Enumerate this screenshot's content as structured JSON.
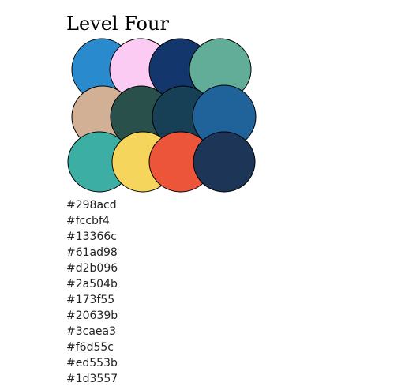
{
  "title": "Level Four",
  "swatches": [
    {
      "hex": "#298acd",
      "icon": "color-swatch"
    },
    {
      "hex": "#fccbf4",
      "icon": "color-swatch"
    },
    {
      "hex": "#13366c",
      "icon": "color-swatch"
    },
    {
      "hex": "#61ad98",
      "icon": "color-swatch"
    },
    {
      "hex": "#d2b096",
      "icon": "color-swatch"
    },
    {
      "hex": "#2a504b",
      "icon": "color-swatch"
    },
    {
      "hex": "#173f55",
      "icon": "color-swatch"
    },
    {
      "hex": "#20639b",
      "icon": "color-swatch"
    },
    {
      "hex": "#3caea3",
      "icon": "color-swatch"
    },
    {
      "hex": "#f6d55c",
      "icon": "color-swatch"
    },
    {
      "hex": "#ed553b",
      "icon": "color-swatch"
    },
    {
      "hex": "#1d3557",
      "icon": "color-swatch"
    }
  ],
  "hex_labels": [
    "#298acd",
    "#fccbf4",
    "#13366c",
    "#61ad98",
    "#d2b096",
    "#2a504b",
    "#173f55",
    "#20639b",
    "#3caea3",
    "#f6d55c",
    "#ed553b",
    "#1d3557"
  ]
}
